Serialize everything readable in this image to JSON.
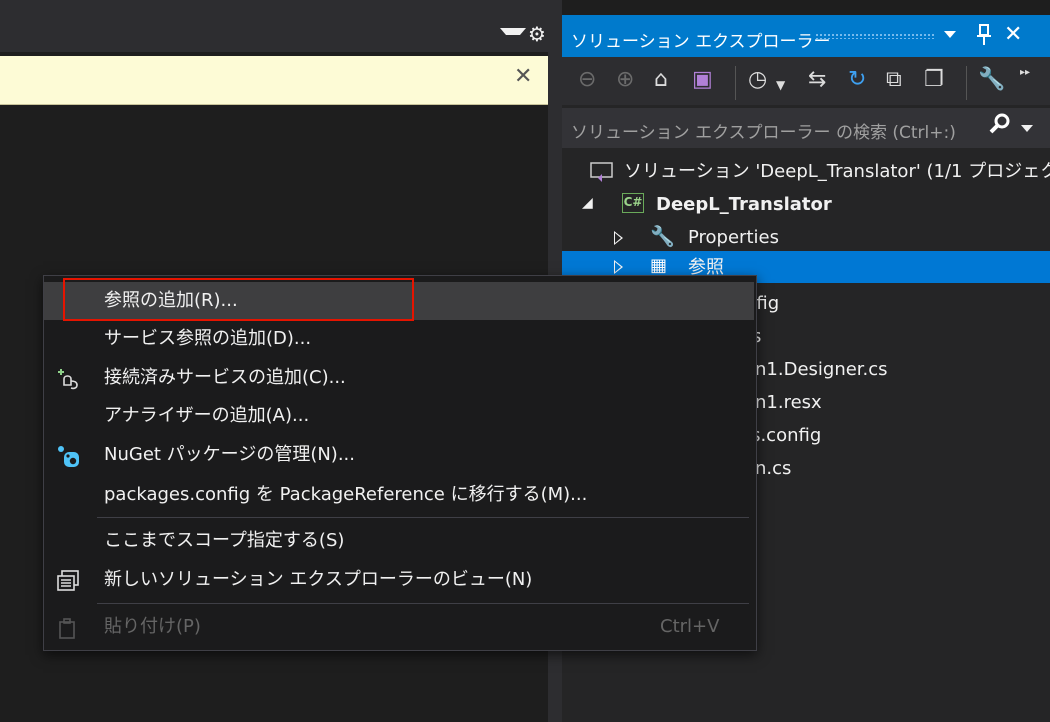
{
  "editor": {
    "gear_icon": "gear-icon",
    "infobar_close": "✕"
  },
  "solution_explorer": {
    "title": "ソリューション エクスプローラー",
    "pin": "📌",
    "close": "✕",
    "search_placeholder": "ソリューション エクスプローラー の検索 (Ctrl+:)",
    "tree": [
      {
        "label": "ソリューション 'DeepL_Translator' (1/1 プロジェクト"
      },
      {
        "label": "DeepL_Translator"
      },
      {
        "label": "Properties"
      },
      {
        "label": "参照"
      },
      {
        "label": "nfig"
      },
      {
        "label": "ts"
      },
      {
        "label": "n1.Designer.cs"
      },
      {
        "label": "n1.resx"
      },
      {
        "label": "es.config"
      },
      {
        "label": "n.cs"
      }
    ]
  },
  "context_menu": {
    "items": [
      {
        "label": "参照の追加(R)..."
      },
      {
        "label": "サービス参照の追加(D)..."
      },
      {
        "label": "接続済みサービスの追加(C)..."
      },
      {
        "label": "アナライザーの追加(A)..."
      },
      {
        "label": "NuGet パッケージの管理(N)..."
      },
      {
        "label": "packages.config を PackageReference に移行する(M)..."
      },
      {
        "label": "ここまでスコープ指定する(S)"
      },
      {
        "label": "新しいソリューション エクスプローラーのビュー(N)"
      },
      {
        "label": "貼り付け(P)",
        "shortcut": "Ctrl+V"
      }
    ]
  },
  "colors": {
    "accent": "#007acc",
    "selection": "#0078d4",
    "highlight_border": "#e51400"
  }
}
